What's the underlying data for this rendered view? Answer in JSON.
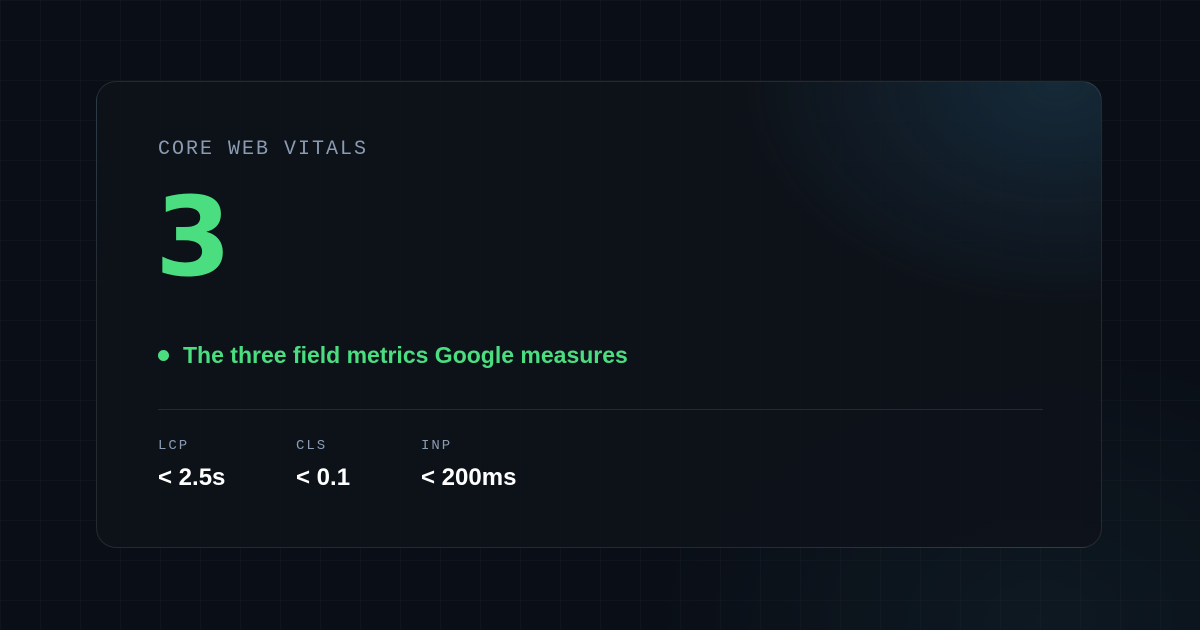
{
  "card": {
    "eyebrow": "CORE WEB VITALS",
    "big_number": "3",
    "caption": "The three field metrics Google measures"
  },
  "metrics": [
    {
      "label": "LCP",
      "value": "< 2.5s"
    },
    {
      "label": "CLS",
      "value": "< 0.1"
    },
    {
      "label": "INP",
      "value": "< 200ms"
    }
  ],
  "colors": {
    "accent": "#4ade80",
    "background": "#0a0e16",
    "muted_text": "#8a9bb2",
    "value_text": "#ffffff"
  },
  "icons": {
    "status_dot": "status-dot-icon"
  }
}
